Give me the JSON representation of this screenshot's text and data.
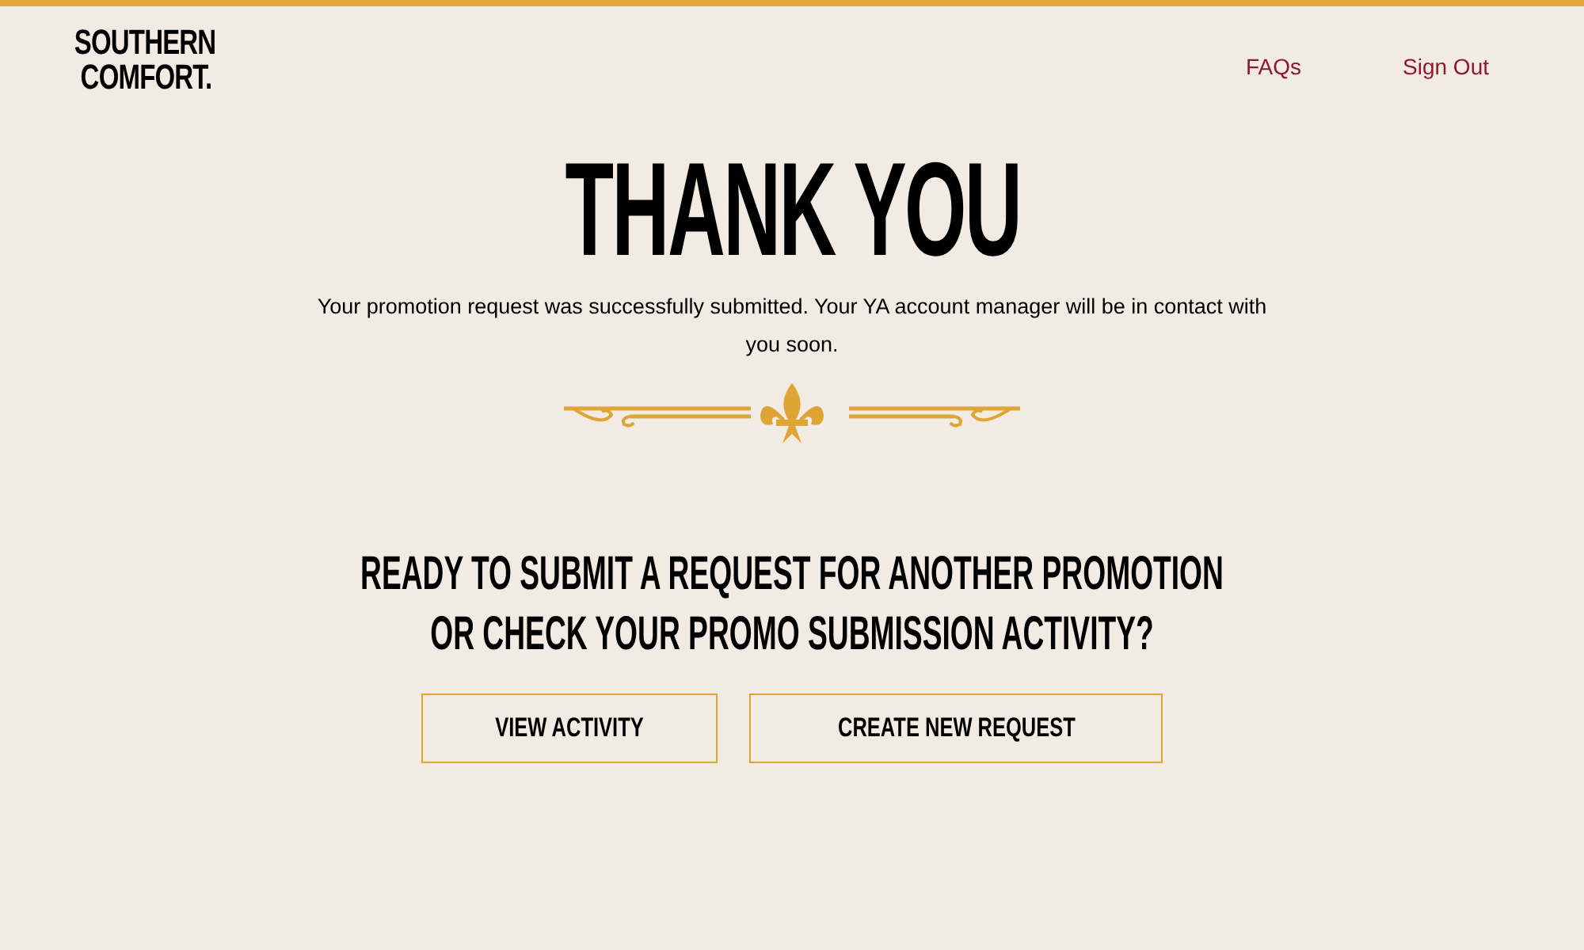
{
  "logo": {
    "line_1": "SOUTHERN",
    "line_2": "COMFORT."
  },
  "nav": [
    {
      "label": "FAQs"
    },
    {
      "label": "Sign Out"
    }
  ],
  "heading": "THANK YOU",
  "message": "Your promotion request was successfully submitted. Your YA account manager will be in contact with you soon.",
  "prompt": "READY TO SUBMIT A REQUEST FOR ANOTHER PROMOTION OR CHECK YOUR PROMO SUBMISSION ACTIVITY?",
  "buttons": [
    {
      "label": "VIEW ACTIVITY"
    },
    {
      "label": "CREATE NEW REQUEST"
    }
  ]
}
